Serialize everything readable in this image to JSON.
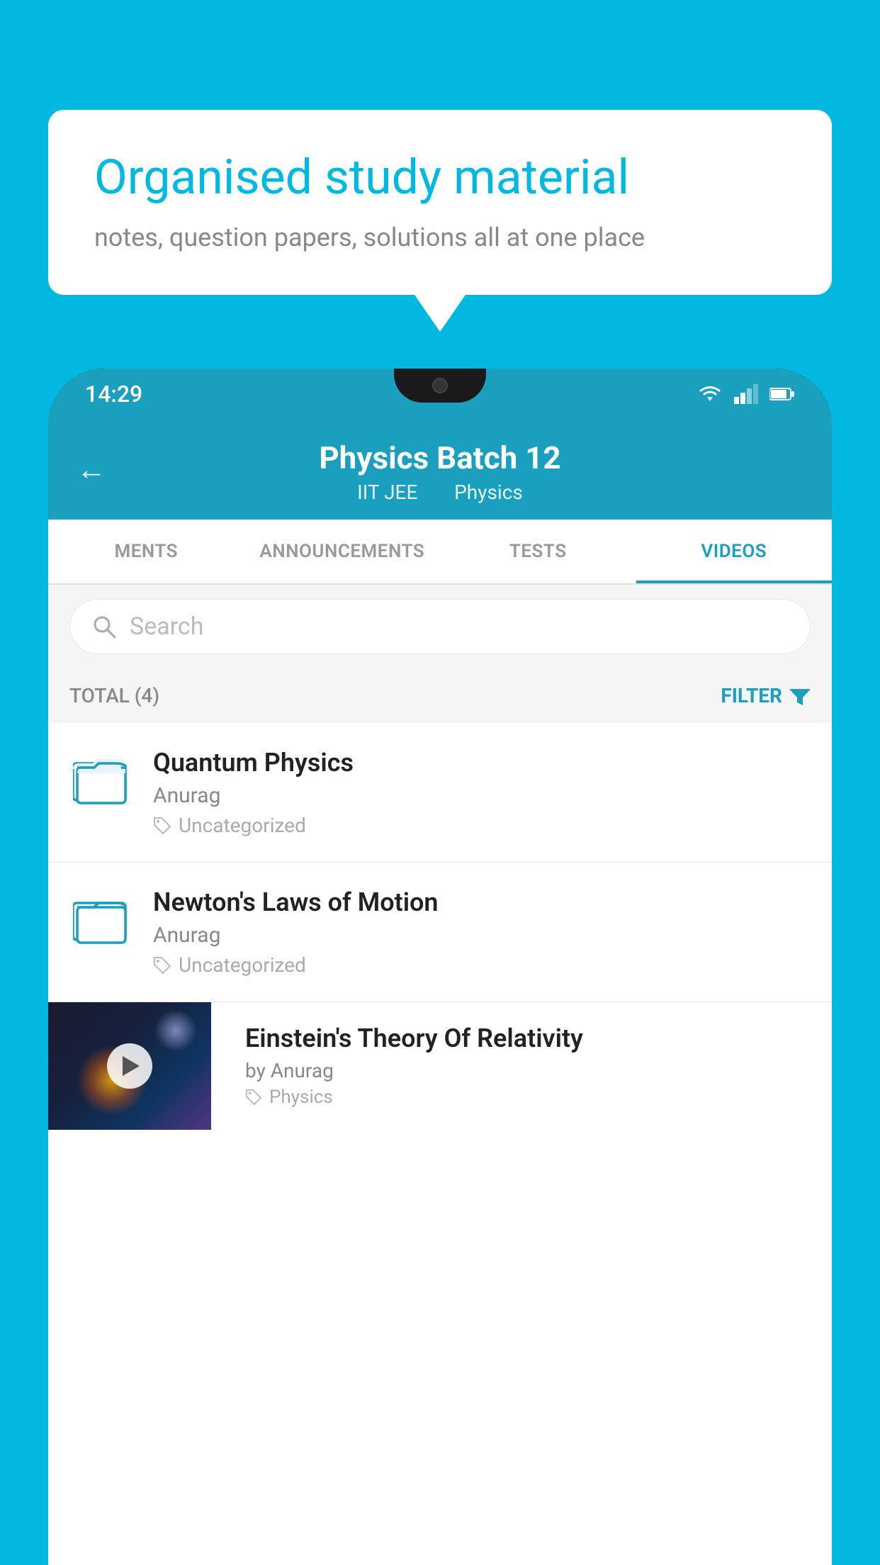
{
  "background_color": "#00b8e0",
  "speech_bubble": {
    "heading": "Organised study material",
    "subtext": "notes, question papers, solutions all at one place"
  },
  "phone": {
    "status_bar": {
      "time": "14:29"
    },
    "header": {
      "title": "Physics Batch 12",
      "subtitle_part1": "IIT JEE",
      "subtitle_part2": "Physics"
    },
    "tabs": [
      {
        "label": "MENTS",
        "active": false
      },
      {
        "label": "ANNOUNCEMENTS",
        "active": false
      },
      {
        "label": "TESTS",
        "active": false
      },
      {
        "label": "VIDEOS",
        "active": true
      }
    ],
    "search": {
      "placeholder": "Search"
    },
    "filter": {
      "total_label": "TOTAL (4)",
      "filter_label": "FILTER"
    },
    "list_items": [
      {
        "id": 1,
        "type": "folder",
        "title": "Quantum Physics",
        "author": "Anurag",
        "tag": "Uncategorized"
      },
      {
        "id": 2,
        "type": "folder",
        "title": "Newton's Laws of Motion",
        "author": "Anurag",
        "tag": "Uncategorized"
      },
      {
        "id": 3,
        "type": "video",
        "title": "Einstein's Theory Of Relativity",
        "author": "Anurag",
        "tag": "Physics"
      }
    ]
  }
}
